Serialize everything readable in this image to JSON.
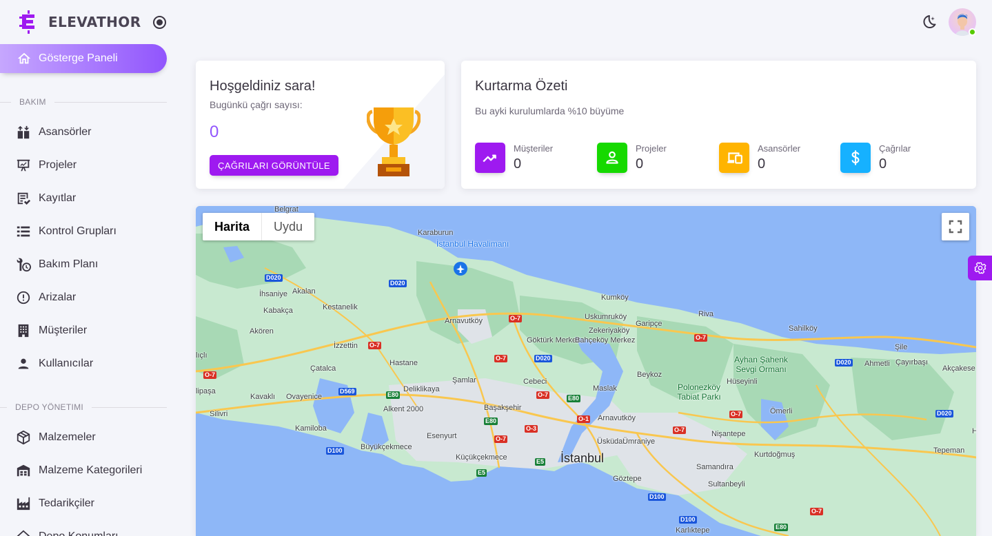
{
  "brand": {
    "name": "ELEVATHOR"
  },
  "nav": {
    "dashboard": "Gösterge Paneli",
    "section_maintenance": "BAKIM",
    "maintenance_items": [
      {
        "label": "Asansörler",
        "icon": "elevator-icon"
      },
      {
        "label": "Projeler",
        "icon": "presentation-icon"
      },
      {
        "label": "Kayıtlar",
        "icon": "records-icon"
      },
      {
        "label": "Kontrol Grupları",
        "icon": "checklist-icon"
      },
      {
        "label": "Bakım Planı",
        "icon": "wrench-clock-icon"
      },
      {
        "label": "Arizalar",
        "icon": "alert-circle-icon"
      },
      {
        "label": "Müşteriler",
        "icon": "office-building-icon"
      },
      {
        "label": "Kullanıcılar",
        "icon": "user-icon"
      }
    ],
    "section_depot": "DEPO YÖNETIMI",
    "depot_items": [
      {
        "label": "Malzemeler",
        "icon": "package-icon"
      },
      {
        "label": "Malzeme Kategorileri",
        "icon": "warehouse-icon"
      },
      {
        "label": "Tedarikçiler",
        "icon": "factory-icon"
      },
      {
        "label": "Depo Konumları",
        "icon": "home-icon"
      }
    ]
  },
  "welcome": {
    "title": "Hoşgeldiniz sara!",
    "subtitle": "Bugünkü çağrı sayısı:",
    "count": "0",
    "button": "ÇAĞRILARI GÖRÜNTÜLE"
  },
  "summary": {
    "title": "Kurtarma Özeti",
    "subtitle": "Bu ayki kurulumlarda %10 büyüme",
    "stats": [
      {
        "label": "Müşteriler",
        "value": "0",
        "color": "#9e1af0",
        "icon": "trending-up-icon"
      },
      {
        "label": "Projeler",
        "value": "0",
        "color": "#16d900",
        "icon": "account-icon"
      },
      {
        "label": "Asansörler",
        "value": "0",
        "color": "#ffb400",
        "icon": "devices-icon"
      },
      {
        "label": "Çağrılar",
        "value": "0",
        "color": "#16b1ff",
        "icon": "dollar-icon"
      }
    ]
  },
  "map": {
    "type_map": "Harita",
    "type_satellite": "Uydu",
    "labels": {
      "istanbul": "İstanbul",
      "airport": "İstanbul Havalimanı",
      "karaburun": "Karaburun",
      "belgrat": "Belgrat",
      "ihsaniye": "İhsaniye",
      "akalan": "Akalan",
      "kestanelik": "Kestanelik",
      "kabakca": "Kabakça",
      "akoren": "Akören",
      "izzettin": "İzzettin",
      "catalca": "Çatalca",
      "hastane": "Hastane",
      "arnavutkoy": "Arnavutköy",
      "gokturk": "Göktürk Merkez",
      "bahcekoy": "Bahçeköy Merkez",
      "kumkoy": "Kumköy",
      "uskumrukoy": "Uskumruköy",
      "zekeriyakoy": "Zekeriyaköy",
      "garipce": "Garipçe",
      "riva": "Riva",
      "sahilkoy": "Sahilköy",
      "sile": "Şile",
      "ahmetli": "Ahmetli",
      "cayirbasi": "Çayırbaşı",
      "akcakese": "Akçakese",
      "aysp": "Ayhan Şahenk Sevgi Ormanı",
      "huseyinli": "Hüseyinli",
      "polonezkoy": "Polonezköy Tabiat Parkı",
      "beykoz": "Beykoz",
      "omerli": "Ömerli",
      "tepeman": "Tepeman",
      "kurtdogmus": "Kurtdoğmuş",
      "nisantepe": "Nişantepe",
      "samandira": "Samandıra",
      "sultanbeyli": "Sultanbeyli",
      "goztepe": "Göztepe",
      "karliktepe": "Karlıktepe",
      "uskudar": "Üsküdar",
      "umraniye": "Ümraniye",
      "arnavutkoy2": "Arnavutköy",
      "maslak": "Maslak",
      "cebeci": "Cebeci",
      "basaksehir": "Başakşehir",
      "samlar": "Şamlar",
      "deliklikaya": "Deliklikaya",
      "alkent": "Alkent 2000",
      "esenyurt": "Esenyurt",
      "kucukcekmece": "Küçükçekmece",
      "buyukcekmece": "Büyükçekmece",
      "kamiloba": "Kamiloba",
      "silivri": "Silivri",
      "kavakli": "Kavaklı",
      "ovayenice": "Ovayenice",
      "lipasa": "lipaşa",
      "ilicli": "lıçlı",
      "h": "H"
    },
    "shields": {
      "d020": "D020",
      "o7": "O-7",
      "e80": "E80",
      "d569": "D569",
      "d100": "D100",
      "e5": "E5",
      "o1": "O-1",
      "o3": "O-3"
    }
  }
}
